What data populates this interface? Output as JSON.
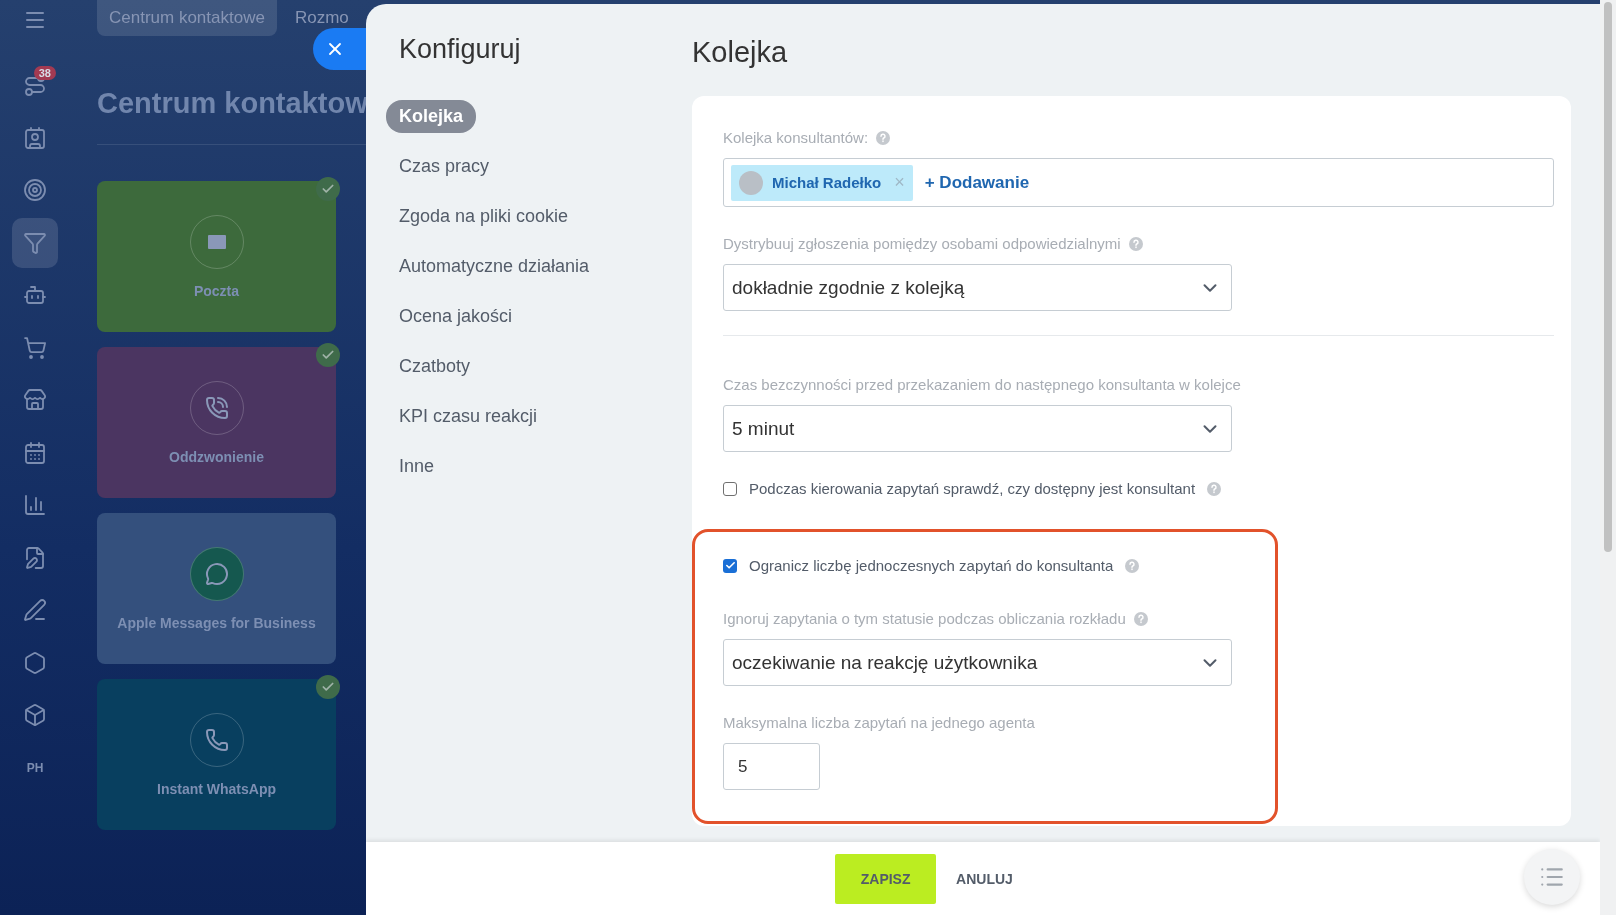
{
  "app_sidebar": {
    "items": [
      {
        "kind": "icon",
        "badge": "38",
        "selected": false
      },
      {
        "kind": "icon",
        "selected": false
      },
      {
        "kind": "icon",
        "selected": false
      },
      {
        "kind": "icon",
        "selected": true
      },
      {
        "kind": "icon",
        "selected": false
      },
      {
        "kind": "icon",
        "selected": false
      },
      {
        "kind": "icon",
        "selected": false
      },
      {
        "kind": "icon",
        "selected": false
      },
      {
        "kind": "icon",
        "selected": false
      },
      {
        "kind": "icon",
        "selected": false
      },
      {
        "kind": "icon",
        "selected": false
      },
      {
        "kind": "icon",
        "selected": false
      },
      {
        "kind": "icon",
        "selected": false
      },
      {
        "kind": "text",
        "text": "PH",
        "selected": false
      }
    ]
  },
  "background": {
    "tabs": [
      {
        "label": "Centrum kontaktowe",
        "selected": true
      },
      {
        "label": "Rozmo",
        "selected": false
      }
    ],
    "title": "Centrum kontaktow",
    "cards": [
      {
        "label": "Poczta",
        "color": "#3d6a3c",
        "connected": true
      },
      {
        "label": "Oddzwonienie",
        "color": "#4b3561",
        "connected": true
      },
      {
        "label": "Apple Messages for Business",
        "color": "#34507d",
        "connected": false
      },
      {
        "label": "Instant WhatsApp",
        "color": "#083f5f",
        "connected": true
      }
    ]
  },
  "settings_panel": {
    "nav_title": "Konfiguruj",
    "nav": [
      {
        "label": "Kolejka",
        "selected": true
      },
      {
        "label": "Czas pracy",
        "selected": false
      },
      {
        "label": "Zgoda na pliki cookie",
        "selected": false
      },
      {
        "label": "Automatyczne działania",
        "selected": false
      },
      {
        "label": "Ocena jakości",
        "selected": false
      },
      {
        "label": "Czatboty",
        "selected": false
      },
      {
        "label": "KPI czasu reakcji",
        "selected": false
      },
      {
        "label": "Inne",
        "selected": false
      }
    ],
    "title": "Kolejka",
    "fields": [
      {
        "kind": "tags",
        "label": "Kolejka konsultantów:",
        "help": true,
        "tags": [
          {
            "name": "Michał Radełko",
            "remove": "×"
          }
        ],
        "add": "+ Dodawanie"
      },
      {
        "kind": "select",
        "label": "Dystrybuuj zgłoszenia pomiędzy osobami odpowiedzialnymi",
        "help": true,
        "value": "dokładnie zgodnie z kolejką"
      },
      {
        "kind": "divider"
      },
      {
        "kind": "select",
        "label": "Czas bezczynności przed przekazaniem do następnego konsultanta w kolejce",
        "help": false,
        "value": "5 minut"
      },
      {
        "kind": "checkbox",
        "label": "Podczas kierowania zapytań sprawdź, czy dostępny jest konsultant",
        "help": true,
        "checked": false
      }
    ],
    "highlighted_fields": [
      {
        "kind": "checkbox",
        "label": "Ogranicz liczbę jednoczesnych zapytań do konsultanta",
        "help": true,
        "checked": true
      },
      {
        "kind": "select",
        "label": "Ignoruj zapytania o tym statusie podczas obliczania rozkładu",
        "help": true,
        "value": "oczekiwanie na reakcję użytkownika"
      },
      {
        "kind": "number",
        "label": "Maksymalna liczba zapytań na jednego agenta",
        "help": false,
        "value": "5"
      }
    ],
    "footer": {
      "save": "ZAPISZ",
      "cancel": "ANULUJ"
    }
  }
}
